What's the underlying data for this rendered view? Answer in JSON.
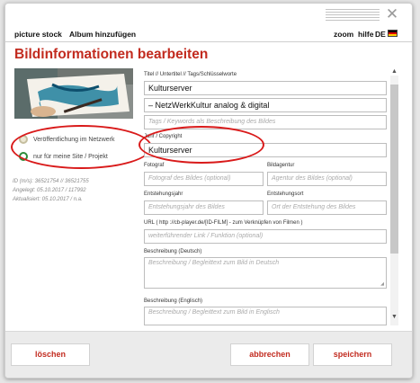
{
  "window": {
    "close_symbol": "✕"
  },
  "menu": {
    "left": [
      "picture stock",
      "Album hinzufügen"
    ],
    "right": [
      "zoom",
      "hilfe",
      "DE"
    ]
  },
  "page_title": "Bildinformationen bearbeiten",
  "visibility": {
    "options": [
      "Veröffentlichung im Netzwerk",
      "nur für meine Site / Projekt"
    ],
    "selected_index": 1
  },
  "meta": {
    "id": "ID (m/s): 36521754 // 36521755",
    "created": "Angelegt: 05.10.2017 / 117992",
    "updated": "Aktualisiert: 05.10.2017 / n.a."
  },
  "form": {
    "title_label": "Titel // Untertitel // Tags/Schlüsselworte",
    "title": "Kulturserver",
    "subtitle": "– NetzWerkKultur analog & digital",
    "tags_placeholder": "Tags / Keywords als Beschreibung des Bildes",
    "year_label": "Jahr / Copyright",
    "year_value": "Kulturserver",
    "photographer_label": "Fotograf",
    "photographer_placeholder": "Fotograf des Bildes (optional)",
    "agency_label": "Bildagentur",
    "agency_placeholder": "Agentur des Bildes (optional)",
    "creation_year_label": "Entstehungsjahr",
    "creation_year_placeholder": "Entstehungsjahr des Bildes",
    "creation_place_label": "Entstehungsort",
    "creation_place_placeholder": "Ort der Entstehung des Bildes",
    "url_label": "URL ( http ://cb-player.de/[ID-FILM] - zum Verknüpfen von Filmen )",
    "url_placeholder": "weiterführender Link / Funktion (optional)",
    "desc_de_label": "Beschreibung (Deutsch)",
    "desc_de_placeholder": "Beschreibung / Begleittext zum Bild in Deutsch",
    "desc_en_label": "Beschreibung (Englisch)",
    "desc_en_placeholder": "Beschreibung / Begleittext zum Bild in Englisch"
  },
  "buttons": {
    "delete": "löschen",
    "cancel": "abbrechen",
    "save": "speichern"
  },
  "colors": {
    "accent": "#c22b1f",
    "highlight": "#d91a1a",
    "radio_on": "#2e8b3a"
  },
  "icons": {
    "close": "close-icon",
    "flag": "flag-de-icon",
    "scroll_up": "chevron-up-icon",
    "scroll_down": "chevron-down-icon"
  }
}
